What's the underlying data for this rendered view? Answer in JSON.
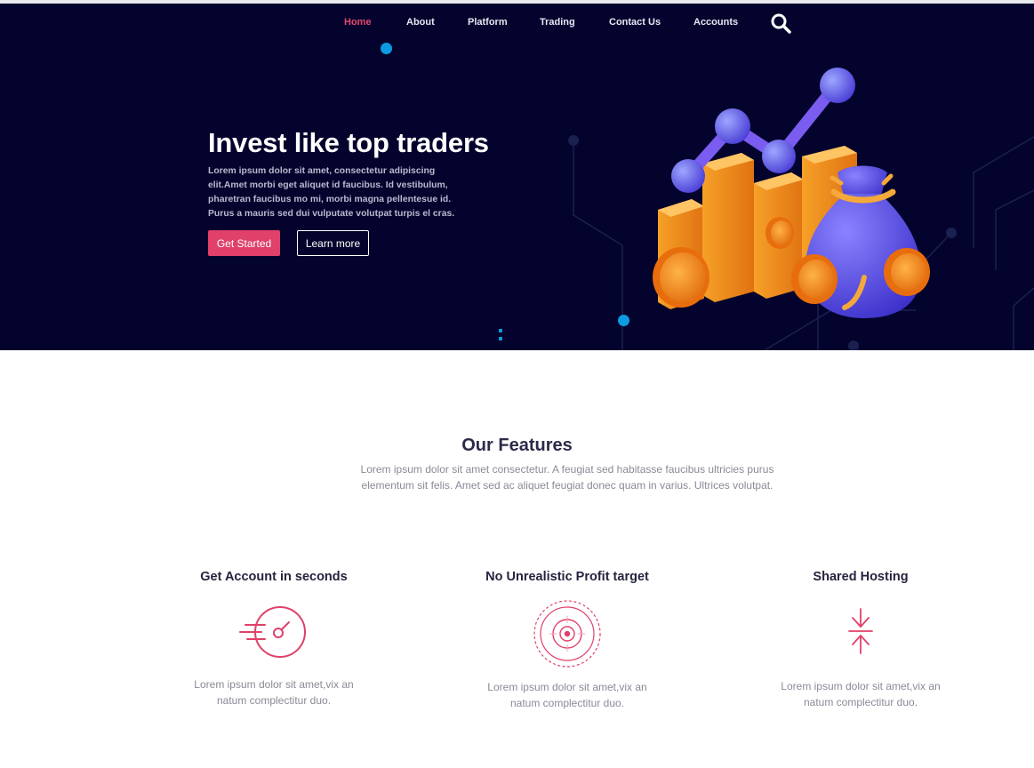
{
  "nav": {
    "items": [
      {
        "label": "Home",
        "active": true
      },
      {
        "label": "About"
      },
      {
        "label": "Platform"
      },
      {
        "label": "Trading"
      },
      {
        "label": "Contact Us"
      },
      {
        "label": "Accounts"
      }
    ],
    "search_icon": "search-icon"
  },
  "hero": {
    "title": "Invest like top traders",
    "description": "Lorem ipsum dolor sit amet, consectetur adipiscing elit.Amet morbi eget aliquet id faucibus. Id vestibulum, pharetran faucibus mo mi, morbi magna pellentesue id. Purus a mauris sed dui vulputate volutpat turpis el cras.",
    "primary_button": "Get Started",
    "secondary_button": "Learn more",
    "illustration": "chart-moneybag-illustration"
  },
  "features": {
    "title": "Our Features",
    "description": "Lorem ipsum dolor sit amet consectetur. A feugiat sed habitasse faucibus ultricies purus elementum sit felis. Amet sed ac aliquet feugiat donec quam in varius. Ultrices volutpat.",
    "items": [
      {
        "title": "Get Account in seconds",
        "icon": "speedometer-icon",
        "text": "Lorem ipsum dolor sit amet,vix an natum complectitur duo."
      },
      {
        "title": "No Unrealistic Profit target",
        "icon": "target-icon",
        "text": "Lorem ipsum dolor sit amet,vix an natum complectitur duo."
      },
      {
        "title": "Shared Hosting",
        "icon": "compress-arrows-icon",
        "text": "Lorem ipsum dolor sit amet,vix an natum complectitur duo."
      }
    ]
  },
  "colors": {
    "hero_bg": "#03032d",
    "accent": "#e0406a",
    "dot": "#0c9be0",
    "heading": "#2b2b48",
    "body_text": "#8a8a98"
  }
}
